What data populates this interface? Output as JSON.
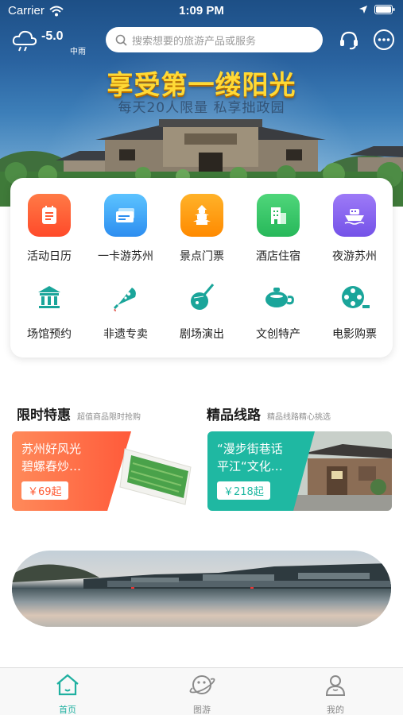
{
  "status_bar": {
    "carrier": "Carrier",
    "time": "1:09 PM"
  },
  "weather": {
    "temperature": "-5.0",
    "condition": "中雨",
    "icon": "rain-cloud-icon"
  },
  "search": {
    "placeholder": "搜索想要的旅游产品或服务"
  },
  "header_buttons": [
    {
      "icon": "customer-service-icon"
    },
    {
      "icon": "more-dots-icon"
    }
  ],
  "banner": {
    "title": "享受第一缕阳光",
    "subtitle": "每天20人限量 私享拙政园"
  },
  "categories": [
    {
      "label": "活动日历",
      "icon": "calendar-icon",
      "color": "#ff6a3d"
    },
    {
      "label": "一卡游苏州",
      "icon": "card-icon",
      "color": "#3aa8f5"
    },
    {
      "label": "景点门票",
      "icon": "pagoda-icon",
      "color": "#ff9f1a"
    },
    {
      "label": "酒店住宿",
      "icon": "hotel-icon",
      "color": "#3ccb6e"
    },
    {
      "label": "夜游苏州",
      "icon": "boat-icon",
      "color": "#8a66f0"
    },
    {
      "label": "场馆预约",
      "icon": "museum-icon",
      "color": "#1aa59a"
    },
    {
      "label": "非遗专卖",
      "icon": "fan-icon",
      "color": "#1aa59a"
    },
    {
      "label": "剧场演出",
      "icon": "pipa-icon",
      "color": "#1aa59a"
    },
    {
      "label": "文创特产",
      "icon": "teapot-icon",
      "color": "#1aa59a"
    },
    {
      "label": "电影购票",
      "icon": "film-reel-icon",
      "color": "#1aa59a"
    }
  ],
  "sections": {
    "flash_sale": {
      "title": "限时特惠",
      "subtitle": "超值商品限时抢购",
      "card": {
        "line1": "苏州好风光",
        "line2": "碧螺春炒…",
        "price": "￥69起",
        "color": "#ff6b4a"
      }
    },
    "routes": {
      "title": "精品线路",
      "subtitle": "精品线路精心挑选",
      "card": {
        "line1": "“漫步街巷话",
        "line2": "平江“文化…",
        "price": "￥218起",
        "color": "#1fb8a2"
      }
    }
  },
  "tabs": [
    {
      "label": "首页",
      "icon": "home-icon",
      "active": true
    },
    {
      "label": "图游",
      "icon": "planet-icon",
      "active": false
    },
    {
      "label": "我的",
      "icon": "user-icon",
      "active": false
    }
  ],
  "colors": {
    "accent": "#1fb0a0",
    "banner_title": "#ffd935"
  }
}
